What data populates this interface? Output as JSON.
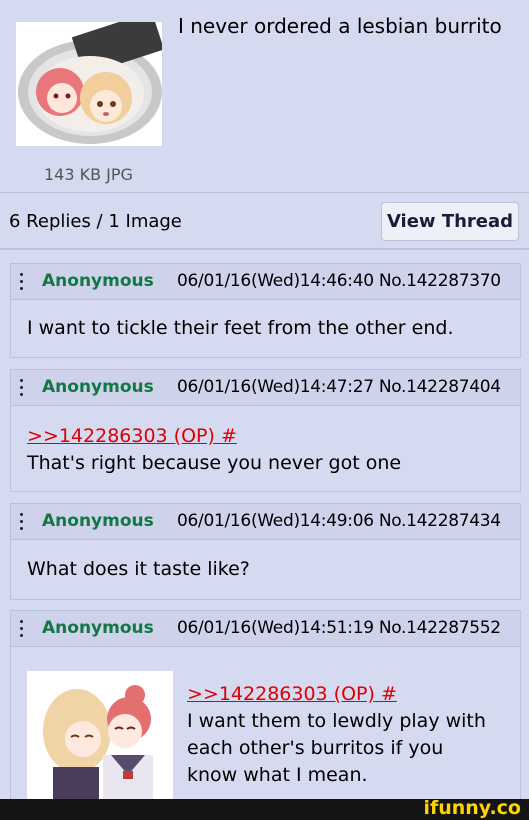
{
  "op": {
    "subject": "I never ordered a lesbian burrito",
    "file_info": "143 KB JPG",
    "thumb_icon": "anime-burrito-image"
  },
  "thread": {
    "reply_summary": "6 Replies / 1 Image",
    "view_label": "View Thread"
  },
  "replies": [
    {
      "name": "Anonymous",
      "meta": "06/01/16(Wed)14:46:40 No.142287370",
      "quote": "",
      "text": "I want to tickle their feet from the other end."
    },
    {
      "name": "Anonymous",
      "meta": "06/01/16(Wed)14:47:27 No.142287404",
      "quote": ">>142286303 (OP) #",
      "text": "That's right because you never got one"
    },
    {
      "name": "Anonymous",
      "meta": "06/01/16(Wed)14:49:06 No.142287434",
      "quote": "",
      "text": "What does it taste like?"
    },
    {
      "name": "Anonymous",
      "meta": "06/01/16(Wed)14:51:19 No.142287552",
      "quote": ">>142286303 (OP) #",
      "text_lines": [
        "I want them to lewdly play with",
        "each other's burritos if you",
        "know what I mean."
      ]
    }
  ],
  "footer": {
    "watermark": "ifunny.co"
  },
  "colors": {
    "background": "#d6daf0",
    "name": "#117743",
    "quote": "#dd0000"
  }
}
